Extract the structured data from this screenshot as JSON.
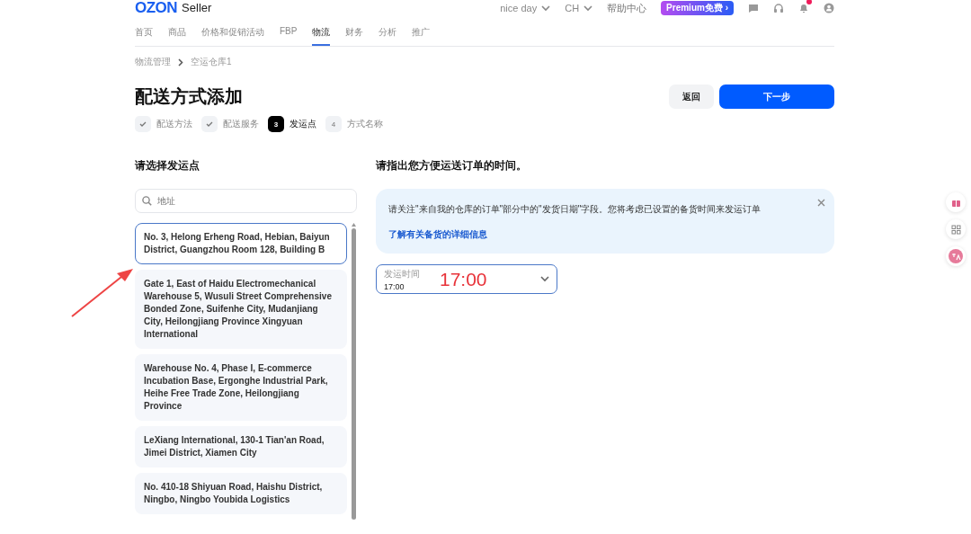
{
  "header": {
    "logo": "OZON",
    "logo_suffix": "Seller",
    "account": "nice day",
    "language": "CH",
    "help": "帮助中心",
    "premium": "Premium免费 ›",
    "notifications_badge": true
  },
  "nav": [
    {
      "label": "首页",
      "selected": false
    },
    {
      "label": "商品",
      "selected": false
    },
    {
      "label": "价格和促销活动",
      "selected": false
    },
    {
      "label": "FBP",
      "selected": false
    },
    {
      "label": "物流",
      "selected": true
    },
    {
      "label": "财务",
      "selected": false
    },
    {
      "label": "分析",
      "selected": false
    },
    {
      "label": "推广",
      "selected": false
    }
  ],
  "breadcrumb": [
    "物流管理",
    "空运仓库1"
  ],
  "title": "配送方式添加",
  "buttons": {
    "back": "返回",
    "next": "下一步"
  },
  "steps": [
    {
      "label": "配送方法",
      "done": true,
      "selected": false
    },
    {
      "label": "配送服务",
      "done": true,
      "selected": false
    },
    {
      "label": "发运点",
      "done": false,
      "selected": true,
      "number": "3"
    },
    {
      "label": "方式名称",
      "done": false,
      "selected": false,
      "number": "4"
    }
  ],
  "left": {
    "heading": "请选择发运点",
    "search": {
      "placeholder": "地址"
    },
    "addresses": [
      {
        "text": "No. 3, Helong Erheng Road, Hebian, Baiyun District, Guangzhou Room 128, Building B",
        "selected": true
      },
      {
        "text": "Gate 1, East of Haidu Electromechanical Warehouse 5, Wusuli Street Comprehensive Bonded Zone, Suifenhe City, Mudanjiang City, Heilongjiang Province Xingyuan International",
        "selected": false
      },
      {
        "text": "Warehouse No. 4, Phase I, E-commerce Incubation Base, Ergonghe Industrial Park, Heihe Free Trade Zone, Heilongjiang Province",
        "selected": false
      },
      {
        "text": "LeXiang International, 130-1 Tian'an Road, Jimei District, Xiamen City",
        "selected": false
      },
      {
        "text": "No. 410-18 Shiyuan Road, Haishu District, Ningbo, Ningbo Youbida Logistics",
        "selected": false
      }
    ]
  },
  "right": {
    "heading": "请指出您方便运送订单的时间。",
    "notice": {
      "text": "请关注\"来自我的仓库的订单\"部分中的\"发货日期\"字段。您将考虑已设置的备货时间来发运订单",
      "link": "了解有关备货的详细信息"
    },
    "time_field": {
      "label": "发运时间",
      "value": "17:00"
    }
  },
  "annotation": {
    "text": "17:00"
  }
}
